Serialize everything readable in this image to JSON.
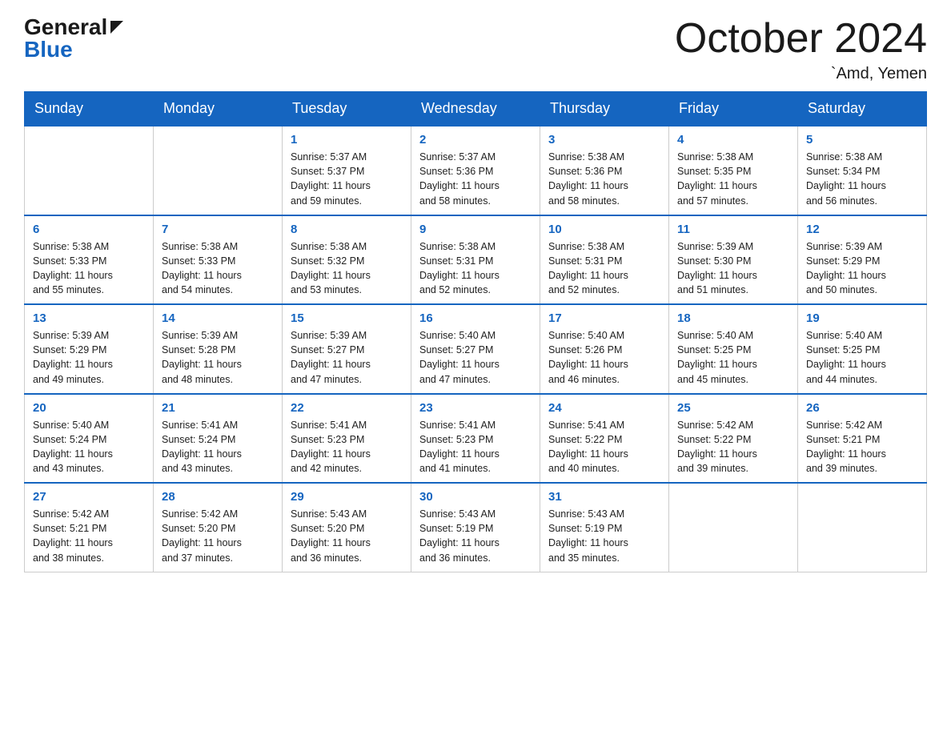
{
  "header": {
    "logo_general": "General",
    "logo_blue": "Blue",
    "month_title": "October 2024",
    "location": "`Amd, Yemen"
  },
  "weekdays": [
    "Sunday",
    "Monday",
    "Tuesday",
    "Wednesday",
    "Thursday",
    "Friday",
    "Saturday"
  ],
  "weeks": [
    [
      {
        "day": "",
        "info": ""
      },
      {
        "day": "",
        "info": ""
      },
      {
        "day": "1",
        "info": "Sunrise: 5:37 AM\nSunset: 5:37 PM\nDaylight: 11 hours\nand 59 minutes."
      },
      {
        "day": "2",
        "info": "Sunrise: 5:37 AM\nSunset: 5:36 PM\nDaylight: 11 hours\nand 58 minutes."
      },
      {
        "day": "3",
        "info": "Sunrise: 5:38 AM\nSunset: 5:36 PM\nDaylight: 11 hours\nand 58 minutes."
      },
      {
        "day": "4",
        "info": "Sunrise: 5:38 AM\nSunset: 5:35 PM\nDaylight: 11 hours\nand 57 minutes."
      },
      {
        "day": "5",
        "info": "Sunrise: 5:38 AM\nSunset: 5:34 PM\nDaylight: 11 hours\nand 56 minutes."
      }
    ],
    [
      {
        "day": "6",
        "info": "Sunrise: 5:38 AM\nSunset: 5:33 PM\nDaylight: 11 hours\nand 55 minutes."
      },
      {
        "day": "7",
        "info": "Sunrise: 5:38 AM\nSunset: 5:33 PM\nDaylight: 11 hours\nand 54 minutes."
      },
      {
        "day": "8",
        "info": "Sunrise: 5:38 AM\nSunset: 5:32 PM\nDaylight: 11 hours\nand 53 minutes."
      },
      {
        "day": "9",
        "info": "Sunrise: 5:38 AM\nSunset: 5:31 PM\nDaylight: 11 hours\nand 52 minutes."
      },
      {
        "day": "10",
        "info": "Sunrise: 5:38 AM\nSunset: 5:31 PM\nDaylight: 11 hours\nand 52 minutes."
      },
      {
        "day": "11",
        "info": "Sunrise: 5:39 AM\nSunset: 5:30 PM\nDaylight: 11 hours\nand 51 minutes."
      },
      {
        "day": "12",
        "info": "Sunrise: 5:39 AM\nSunset: 5:29 PM\nDaylight: 11 hours\nand 50 minutes."
      }
    ],
    [
      {
        "day": "13",
        "info": "Sunrise: 5:39 AM\nSunset: 5:29 PM\nDaylight: 11 hours\nand 49 minutes."
      },
      {
        "day": "14",
        "info": "Sunrise: 5:39 AM\nSunset: 5:28 PM\nDaylight: 11 hours\nand 48 minutes."
      },
      {
        "day": "15",
        "info": "Sunrise: 5:39 AM\nSunset: 5:27 PM\nDaylight: 11 hours\nand 47 minutes."
      },
      {
        "day": "16",
        "info": "Sunrise: 5:40 AM\nSunset: 5:27 PM\nDaylight: 11 hours\nand 47 minutes."
      },
      {
        "day": "17",
        "info": "Sunrise: 5:40 AM\nSunset: 5:26 PM\nDaylight: 11 hours\nand 46 minutes."
      },
      {
        "day": "18",
        "info": "Sunrise: 5:40 AM\nSunset: 5:25 PM\nDaylight: 11 hours\nand 45 minutes."
      },
      {
        "day": "19",
        "info": "Sunrise: 5:40 AM\nSunset: 5:25 PM\nDaylight: 11 hours\nand 44 minutes."
      }
    ],
    [
      {
        "day": "20",
        "info": "Sunrise: 5:40 AM\nSunset: 5:24 PM\nDaylight: 11 hours\nand 43 minutes."
      },
      {
        "day": "21",
        "info": "Sunrise: 5:41 AM\nSunset: 5:24 PM\nDaylight: 11 hours\nand 43 minutes."
      },
      {
        "day": "22",
        "info": "Sunrise: 5:41 AM\nSunset: 5:23 PM\nDaylight: 11 hours\nand 42 minutes."
      },
      {
        "day": "23",
        "info": "Sunrise: 5:41 AM\nSunset: 5:23 PM\nDaylight: 11 hours\nand 41 minutes."
      },
      {
        "day": "24",
        "info": "Sunrise: 5:41 AM\nSunset: 5:22 PM\nDaylight: 11 hours\nand 40 minutes."
      },
      {
        "day": "25",
        "info": "Sunrise: 5:42 AM\nSunset: 5:22 PM\nDaylight: 11 hours\nand 39 minutes."
      },
      {
        "day": "26",
        "info": "Sunrise: 5:42 AM\nSunset: 5:21 PM\nDaylight: 11 hours\nand 39 minutes."
      }
    ],
    [
      {
        "day": "27",
        "info": "Sunrise: 5:42 AM\nSunset: 5:21 PM\nDaylight: 11 hours\nand 38 minutes."
      },
      {
        "day": "28",
        "info": "Sunrise: 5:42 AM\nSunset: 5:20 PM\nDaylight: 11 hours\nand 37 minutes."
      },
      {
        "day": "29",
        "info": "Sunrise: 5:43 AM\nSunset: 5:20 PM\nDaylight: 11 hours\nand 36 minutes."
      },
      {
        "day": "30",
        "info": "Sunrise: 5:43 AM\nSunset: 5:19 PM\nDaylight: 11 hours\nand 36 minutes."
      },
      {
        "day": "31",
        "info": "Sunrise: 5:43 AM\nSunset: 5:19 PM\nDaylight: 11 hours\nand 35 minutes."
      },
      {
        "day": "",
        "info": ""
      },
      {
        "day": "",
        "info": ""
      }
    ]
  ]
}
